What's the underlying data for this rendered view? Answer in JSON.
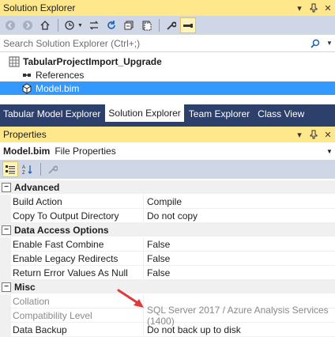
{
  "solution_explorer": {
    "title": "Solution Explorer",
    "title_controls": [
      "▾",
      "📌",
      "✕"
    ],
    "toolbar": {
      "buttons": [
        "back-icon",
        "forward-icon",
        "home-icon",
        "history-icon",
        "sync-icon",
        "refresh-icon",
        "collapse-icon",
        "properties-icon",
        "preview-icon"
      ]
    },
    "search_placeholder": "Search Solution Explorer (Ctrl+;)",
    "tree": {
      "project": "TabularProjectImport_Upgrade",
      "references": "References",
      "model": "Model.bim"
    }
  },
  "tabs": [
    "Tabular Model Explorer",
    "Solution Explorer",
    "Team Explorer",
    "Class View"
  ],
  "active_tab": "Solution Explorer",
  "properties": {
    "title": "Properties",
    "object_name": "Model.bim",
    "object_type": "File Properties",
    "categories": [
      {
        "name": "Advanced",
        "rows": [
          {
            "name": "Build Action",
            "value": "Compile"
          },
          {
            "name": "Copy To Output Directory",
            "value": "Do not copy"
          }
        ]
      },
      {
        "name": "Data Access Options",
        "rows": [
          {
            "name": "Enable Fast Combine",
            "value": "False"
          },
          {
            "name": "Enable Legacy Redirects",
            "value": "False"
          },
          {
            "name": "Return Error Values As Null",
            "value": "False"
          }
        ]
      },
      {
        "name": "Misc",
        "rows": [
          {
            "name": "Collation",
            "value": ""
          },
          {
            "name": "Compatibility Level",
            "value": "SQL Server 2017 / Azure Analysis Services (1400)"
          },
          {
            "name": "Data Backup",
            "value": "Do not back up to disk"
          }
        ]
      }
    ]
  },
  "colors": {
    "title_bar": "#ffe88c",
    "toolbar": "#cfd6e5",
    "tab_strip": "#2d3f6b",
    "selection": "#3399ff",
    "annotation_arrow": "#e03a3a"
  }
}
